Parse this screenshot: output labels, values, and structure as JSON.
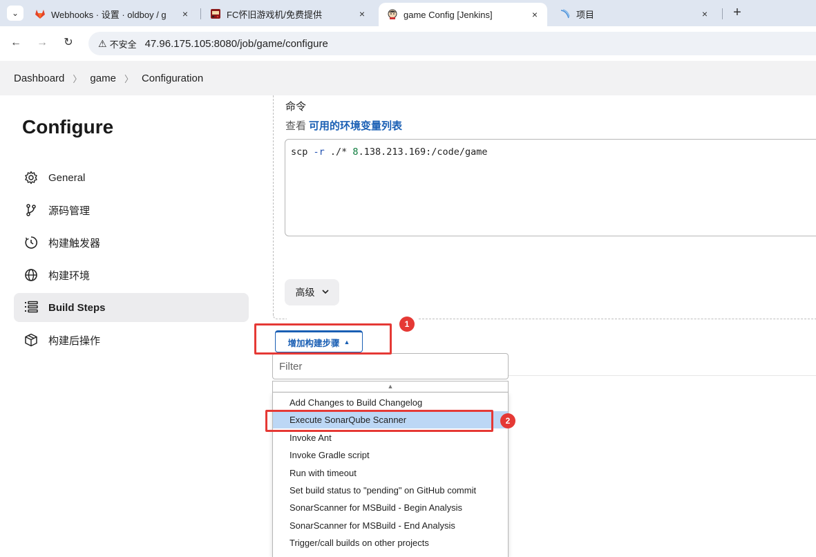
{
  "browser": {
    "tabs": [
      {
        "title": "Webhooks · 设置 · oldboy / g",
        "close": "×"
      },
      {
        "title": "FC怀旧游戏机/免费提供",
        "close": "×"
      },
      {
        "title": "game Config [Jenkins]",
        "close": "×"
      },
      {
        "title": "项目",
        "close": "×"
      }
    ],
    "new_tab": "+",
    "security_label": "不安全",
    "url": "47.96.175.105:8080/job/game/configure"
  },
  "breadcrumb": {
    "items": [
      "Dashboard",
      "game",
      "Configuration"
    ]
  },
  "sidebar": {
    "title": "Configure",
    "items": [
      {
        "label": "General",
        "icon": "gear-icon"
      },
      {
        "label": "源码管理",
        "icon": "branch-icon"
      },
      {
        "label": "构建触发器",
        "icon": "clock-icon"
      },
      {
        "label": "构建环境",
        "icon": "globe-icon"
      },
      {
        "label": "Build Steps",
        "icon": "list-icon",
        "active": true
      },
      {
        "label": "构建后操作",
        "icon": "box-icon"
      }
    ]
  },
  "main": {
    "command_label": "命令",
    "env_prefix": "查看",
    "env_link": "可用的环境变量列表",
    "command": {
      "part1": "scp ",
      "flag": "-r",
      "part2": " ./* ",
      "num": "8",
      "part3": ".138.213.169:/code/game"
    },
    "advanced_label": "高级",
    "add_step_label": "增加构建步骤",
    "filter_placeholder": "Filter",
    "menu_items": [
      "Add Changes to Build Changelog",
      "Execute SonarQube Scanner",
      "Invoke Ant",
      "Invoke Gradle script",
      "Run with timeout",
      "Set build status to \"pending\" on GitHub commit",
      "SonarScanner for MSBuild - Begin Analysis",
      "SonarScanner for MSBuild - End Analysis",
      "Trigger/call builds on other projects"
    ],
    "selected_index": 1
  },
  "annotations": {
    "badge1": "1",
    "badge2": "2",
    "accent_color": "#e53935"
  }
}
